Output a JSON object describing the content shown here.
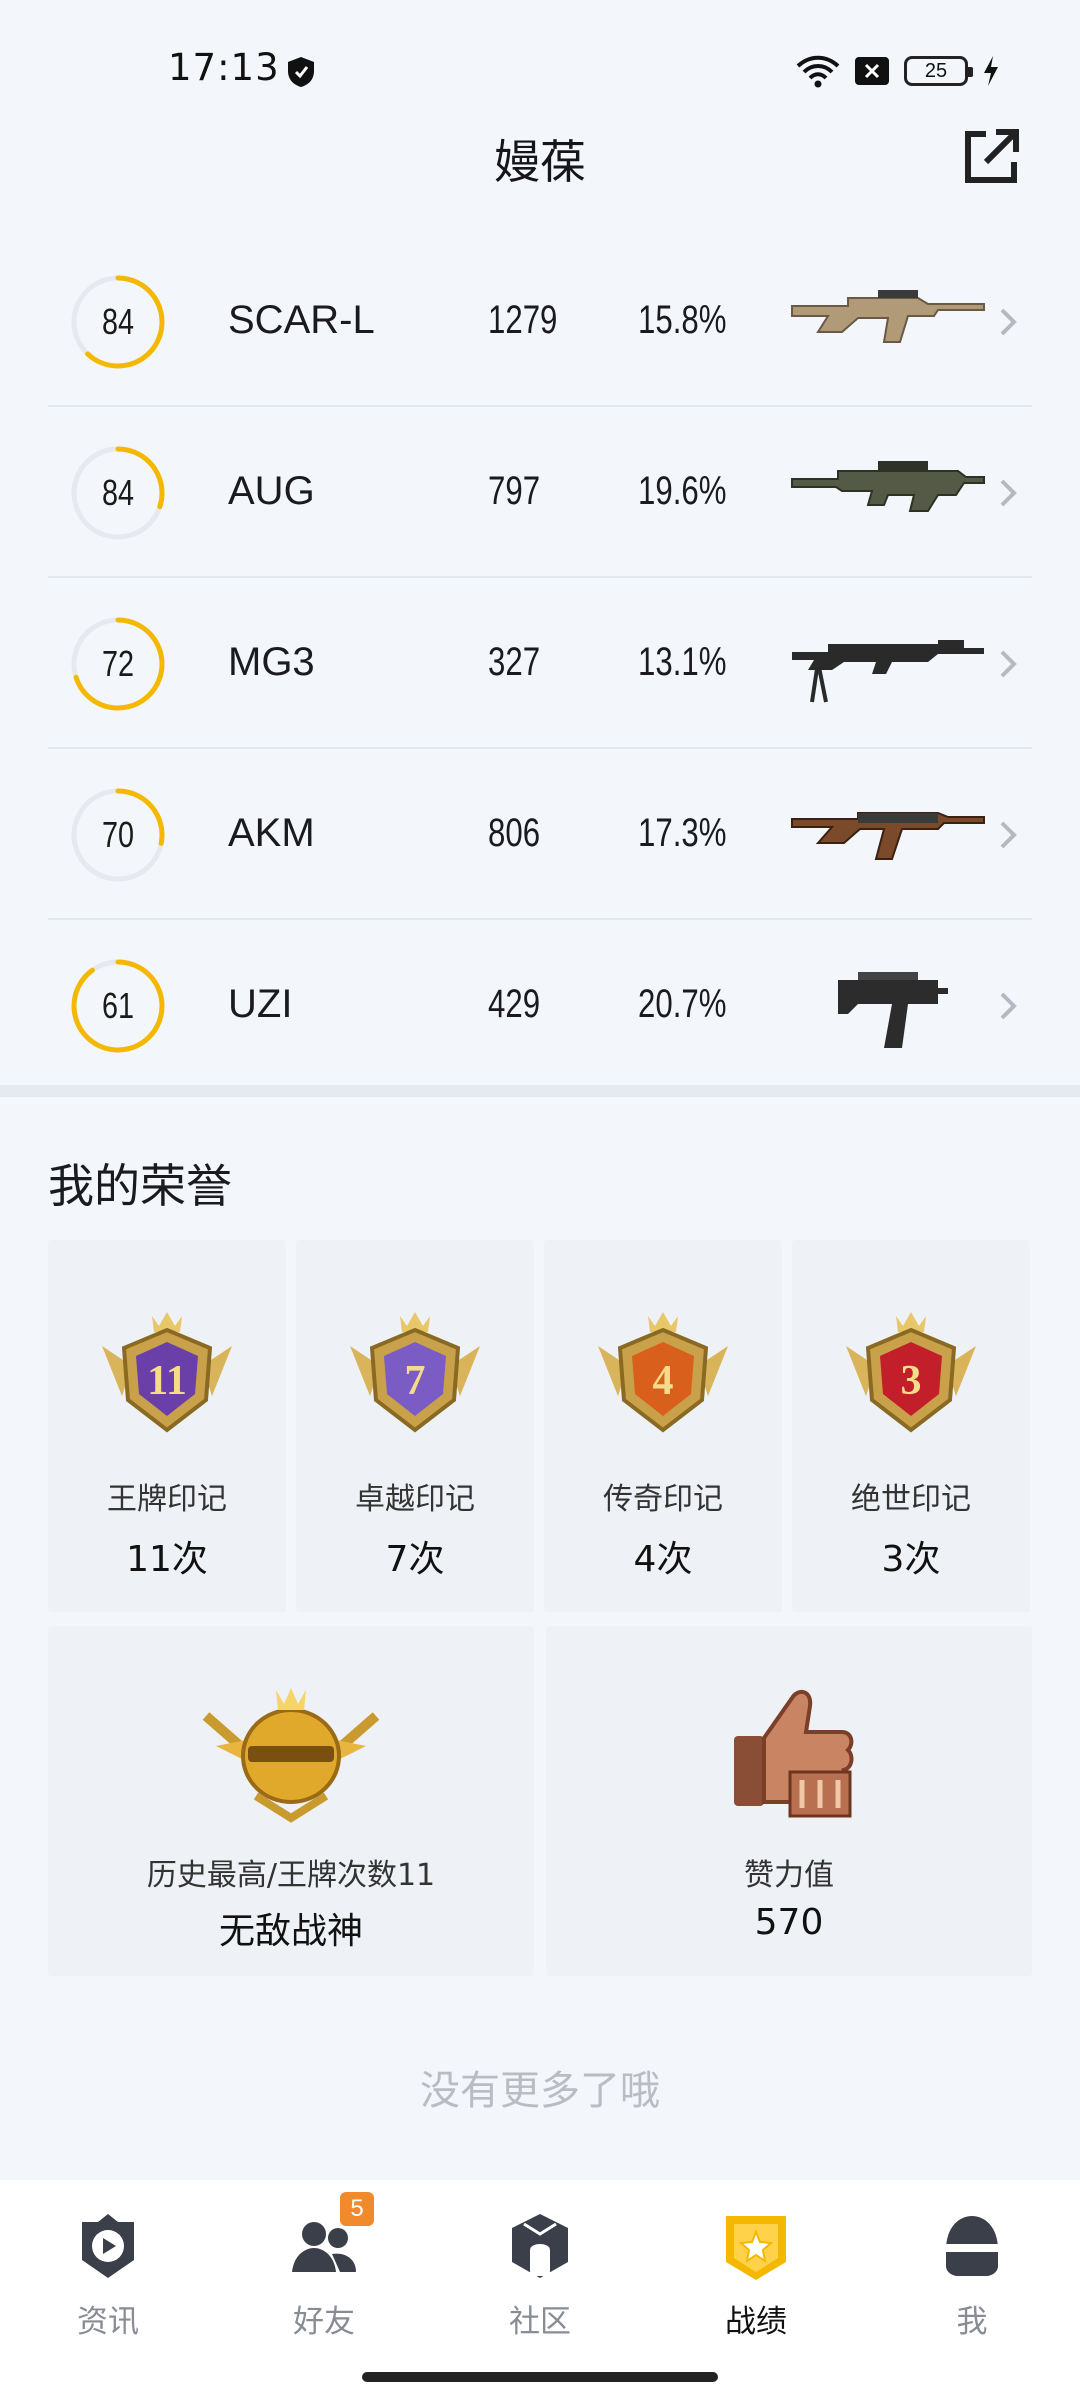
{
  "status": {
    "time": "17:13",
    "battery": "25"
  },
  "header": {
    "title": "嫚葆"
  },
  "weapons": [
    {
      "score": "84",
      "name": "SCAR-L",
      "count": "1279",
      "pct": "15.8%",
      "ring_fraction": 0.62,
      "icon": "scar-l-rifle-icon"
    },
    {
      "score": "84",
      "name": "AUG",
      "count": "797",
      "pct": "19.6%",
      "ring_fraction": 0.3,
      "icon": "aug-rifle-icon"
    },
    {
      "score": "72",
      "name": "MG3",
      "count": "327",
      "pct": "13.1%",
      "ring_fraction": 0.7,
      "icon": "mg3-machinegun-icon"
    },
    {
      "score": "70",
      "name": "AKM",
      "count": "806",
      "pct": "17.3%",
      "ring_fraction": 0.28,
      "icon": "akm-rifle-icon"
    },
    {
      "score": "61",
      "name": "UZI",
      "count": "429",
      "pct": "20.7%",
      "ring_fraction": 0.9,
      "icon": "uzi-smg-icon"
    }
  ],
  "honors": {
    "title": "我的荣誉",
    "badges": [
      {
        "number": "11",
        "label": "王牌印记",
        "count": "11次",
        "color": "#6b3fa8"
      },
      {
        "number": "7",
        "label": "卓越印记",
        "count": "7次",
        "color": "#7b5cc4"
      },
      {
        "number": "4",
        "label": "传奇印记",
        "count": "4次",
        "color": "#d8601c"
      },
      {
        "number": "3",
        "label": "绝世印记",
        "count": "3次",
        "color": "#c21f2a"
      }
    ],
    "highest": {
      "label": "历史最高/王牌次数11",
      "value": "无敌战神"
    },
    "likes": {
      "label": "赞力值",
      "value": "570"
    }
  },
  "footer_note": "没有更多了哦",
  "tabs": [
    {
      "label": "资讯",
      "icon": "news-play-icon"
    },
    {
      "label": "好友",
      "icon": "friends-icon",
      "badge": "5"
    },
    {
      "label": "社区",
      "icon": "community-icon"
    },
    {
      "label": "战绩",
      "icon": "record-badge-icon",
      "active": true
    },
    {
      "label": "我",
      "icon": "profile-helmet-icon"
    }
  ],
  "colors": {
    "accent": "#f5b800",
    "ring_track": "#e6e9ef"
  }
}
